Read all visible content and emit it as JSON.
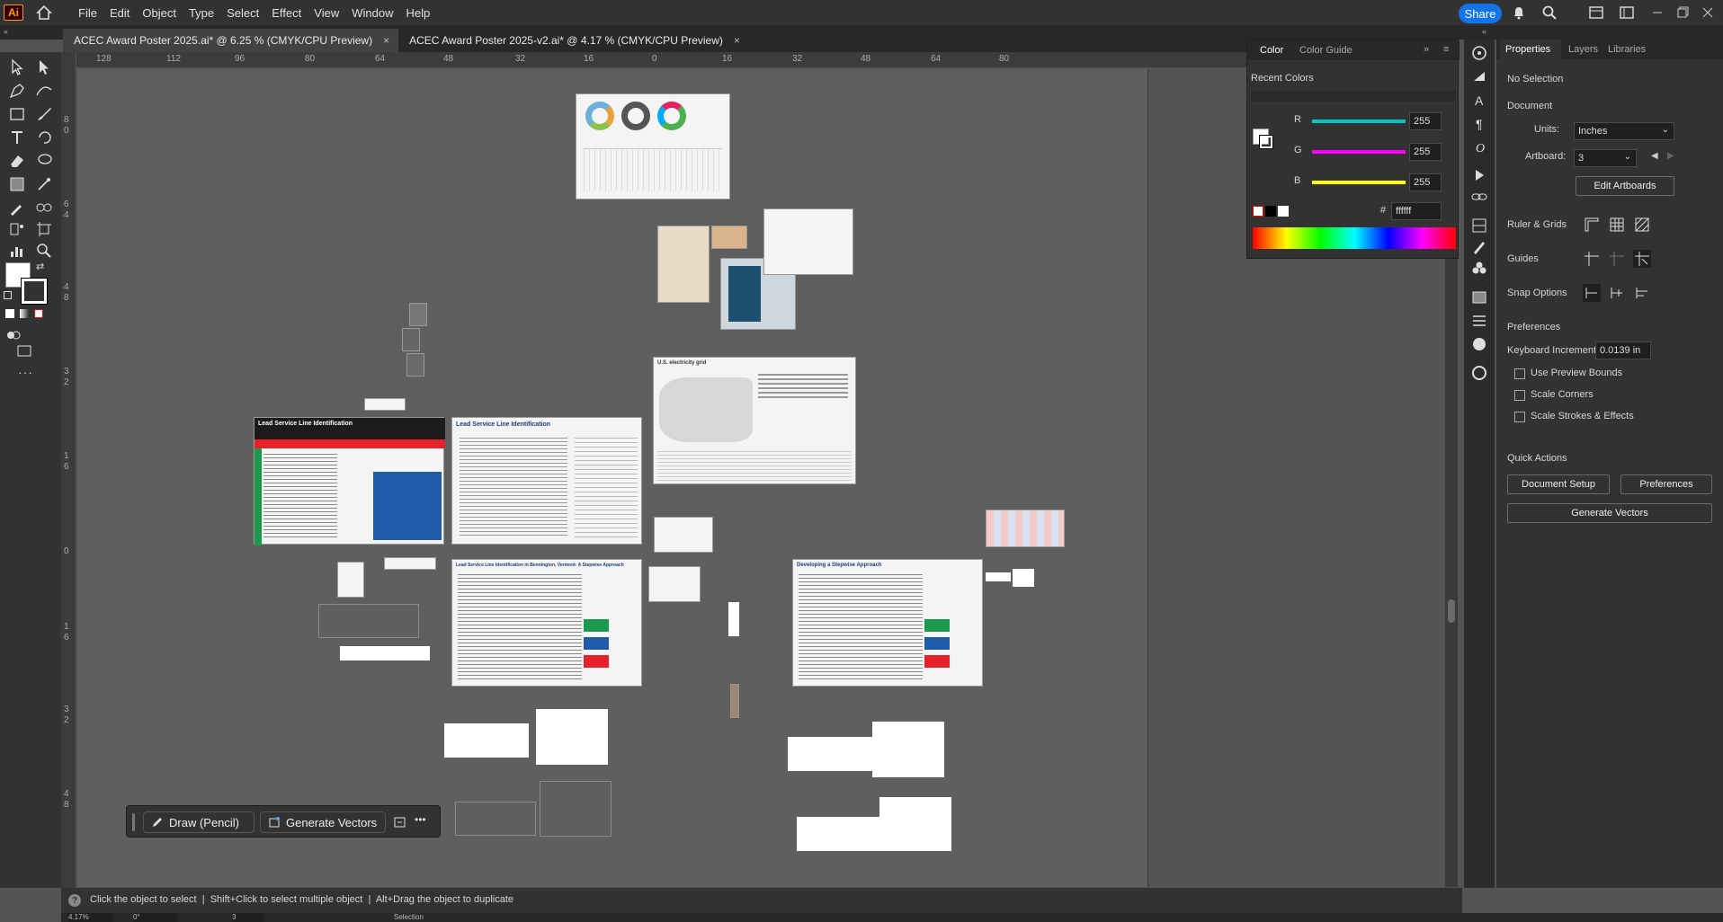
{
  "menubar": {
    "app_logo": "Ai",
    "items": [
      "File",
      "Edit",
      "Object",
      "Type",
      "Select",
      "Effect",
      "View",
      "Window",
      "Help"
    ],
    "share_label": "Share"
  },
  "tabs": [
    {
      "label": "ACEC Award Poster 2025.ai* @ 6.25 % (CMYK/CPU Preview)",
      "close": "×"
    },
    {
      "label": "ACEC Award Poster 2025-v2.ai* @ 4.17 % (CMYK/CPU Preview)",
      "close": "×"
    }
  ],
  "ruler": {
    "h_ticks": [
      "128",
      "112",
      "96",
      "80",
      "64",
      "48",
      "32",
      "16",
      "0",
      "16",
      "32",
      "48",
      "64",
      "80"
    ],
    "v_ticks": [
      "8",
      "0",
      "6",
      "4",
      "4",
      "8",
      "3",
      "2",
      "1",
      "6",
      "0",
      "1",
      "6",
      "3",
      "2",
      "4",
      "8"
    ]
  },
  "color_panel": {
    "tabs": [
      "Color",
      "Color Guide"
    ],
    "recent_label": "Recent Colors",
    "channels": [
      {
        "name": "R",
        "value": "255",
        "color": "#00c8c8"
      },
      {
        "name": "G",
        "value": "255",
        "color": "#ff00ff"
      },
      {
        "name": "B",
        "value": "255",
        "color": "#ffff00"
      }
    ],
    "hash": "#",
    "hex_value": "ffffff"
  },
  "properties": {
    "tabs": [
      "Properties",
      "Layers",
      "Libraries"
    ],
    "selection": "No Selection",
    "document_heading": "Document",
    "units_label": "Units:",
    "units_value": "Inches",
    "artboard_label": "Artboard:",
    "artboard_value": "3",
    "edit_artboards": "Edit Artboards",
    "ruler_grids": "Ruler & Grids",
    "guides": "Guides",
    "snap_options": "Snap Options",
    "preferences_heading": "Preferences",
    "keyboard_increment_label": "Keyboard Increment:",
    "keyboard_increment_value": "0.0139 in",
    "use_preview_bounds": "Use Preview Bounds",
    "scale_corners": "Scale Corners",
    "scale_strokes": "Scale Strokes & Effects",
    "quick_actions": "Quick Actions",
    "document_setup": "Document Setup",
    "preferences_btn": "Preferences",
    "generate_vectors": "Generate Vectors"
  },
  "context_bar": {
    "draw_label": "Draw (Pencil)",
    "generate_label": "Generate Vectors",
    "more": "•••"
  },
  "status": {
    "help_icon": "?",
    "hint": "Click the object to select  |  Shift+Click to select multiple object  |  Alt+Drag the object to duplicate",
    "zoom": "4.17%",
    "rotation": "0°",
    "artboard": "3",
    "tool": "Selection"
  },
  "artboards": {
    "poster1_title": "Lead Service Line Identification",
    "poster2_title": "Lead Service Line Identification",
    "poster3_title": "Lead Service Line Identification in Bennington, Vermont: A Stepwise Approach",
    "poster4_title": "Developing a Stepwise Approach",
    "map_title": "U.S. electricity grid"
  }
}
